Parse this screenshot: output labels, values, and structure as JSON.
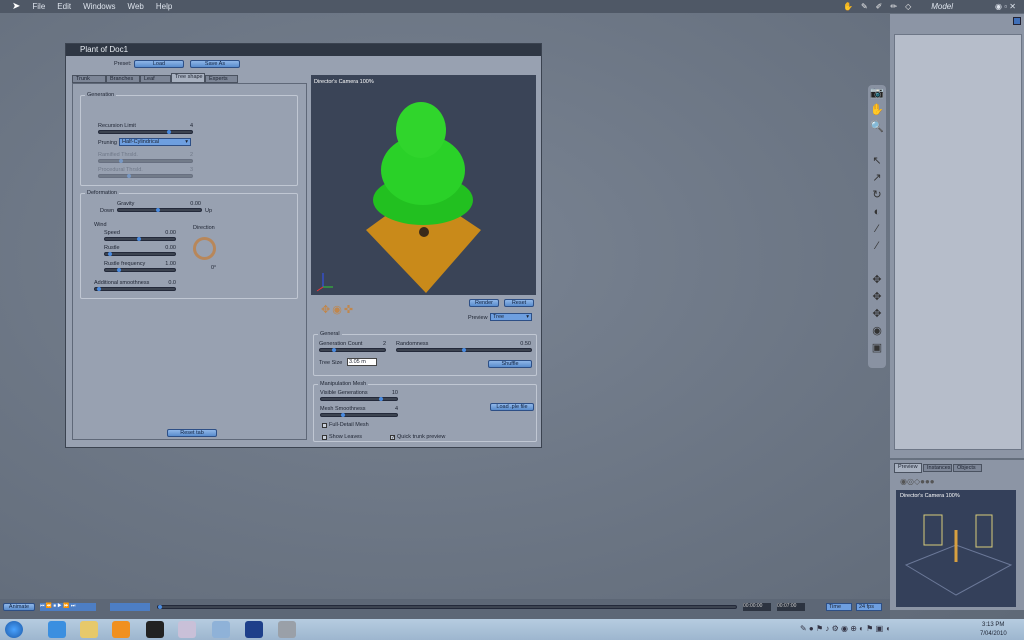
{
  "menu": [
    "File",
    "Edit",
    "Windows",
    "Web",
    "Help"
  ],
  "room": "Model",
  "dialog": {
    "title": "Plant of Doc1",
    "preset_label": "Preset:",
    "load": "Load",
    "save_as": "Save As",
    "tabs": [
      "Trunk",
      "Branches",
      "Leaf",
      "Tree shape",
      "Experts"
    ],
    "generation": {
      "title": "Generation",
      "recursion_label": "Recursion Limit",
      "recursion": "4",
      "pruning_label": "Pruning",
      "pruning": "Half-Cylindrical",
      "ramified_label": "Ramified Thrsld.",
      "ramified": "2",
      "procedural_label": "Procedural Thrsld.",
      "procedural": "3"
    },
    "deformation": {
      "title": "Deformation",
      "gravity_label": "Gravity",
      "gravity": "0.00",
      "down": "Down",
      "up": "Up",
      "wind": "Wind",
      "speed_label": "Speed",
      "speed": "0.00",
      "rustle_label": "Rustle",
      "rustle": "0.00",
      "rustle_freq_label": "Rustle frequency",
      "rustle_freq": "1.00",
      "smooth_label": "Additional smoothness",
      "smooth": "0.0",
      "direction_label": "Direction",
      "direction": "0°"
    },
    "reset_tab": "Reset tab",
    "camera": "Director's Camera 100%",
    "render": "Render",
    "reset": "Reset",
    "preview_label": "Preview",
    "preview": "Tree",
    "general": {
      "title": "General",
      "gen_count_label": "Generation Count",
      "gen_count": "2",
      "randomness_label": "Randomness",
      "randomness": "0.50",
      "tree_size_label": "Tree Size",
      "tree_size": "3.05 m",
      "shuffle": "Shuffle"
    },
    "mesh": {
      "title": "Manipulation Mesh",
      "visible_label": "Visible Generations",
      "visible": "10",
      "smooth_label": "Mesh Smoothness",
      "smooth": "4",
      "load_file": "Load .ple file",
      "full_detail": "Full-Detail Mesh",
      "show_leaves": "Show Leaves",
      "quick_trunk": "Quick trunk preview"
    }
  },
  "right": {
    "tabs": [
      "Preview",
      "Instances",
      "Objects"
    ],
    "camera": "Director's Camera 100%"
  },
  "timeline": {
    "animate": "Animate",
    "start": "00:00:00",
    "end": "00:07:00",
    "time": "Time",
    "fps": "24 fps"
  },
  "taskbar": {
    "time": "3:13 PM",
    "date": "7/04/2010"
  }
}
